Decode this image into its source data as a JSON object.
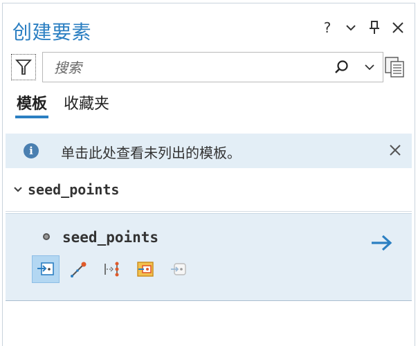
{
  "pane": {
    "title": "创建要素",
    "help_label": "?",
    "colors": {
      "accent": "#2b7fc2",
      "info_bg": "#e3eef6",
      "selected_bg": "#e4eef6"
    }
  },
  "search": {
    "placeholder": "搜索",
    "value": ""
  },
  "tabs": [
    {
      "label": "模板",
      "active": true
    },
    {
      "label": "收藏夹",
      "active": false
    }
  ],
  "info": {
    "message": "单击此处查看未列出的模板。"
  },
  "group": {
    "label": "seed_points",
    "expanded": true
  },
  "template": {
    "name": "seed_points",
    "tools": [
      {
        "icon": "point-tool-icon",
        "selected": true
      },
      {
        "icon": "point-at-end-of-line-icon",
        "selected": false
      },
      {
        "icon": "point-along-line-icon",
        "selected": false
      },
      {
        "icon": "point-at-center-icon",
        "selected": false
      },
      {
        "icon": "xy-point-icon",
        "selected": false
      }
    ]
  }
}
